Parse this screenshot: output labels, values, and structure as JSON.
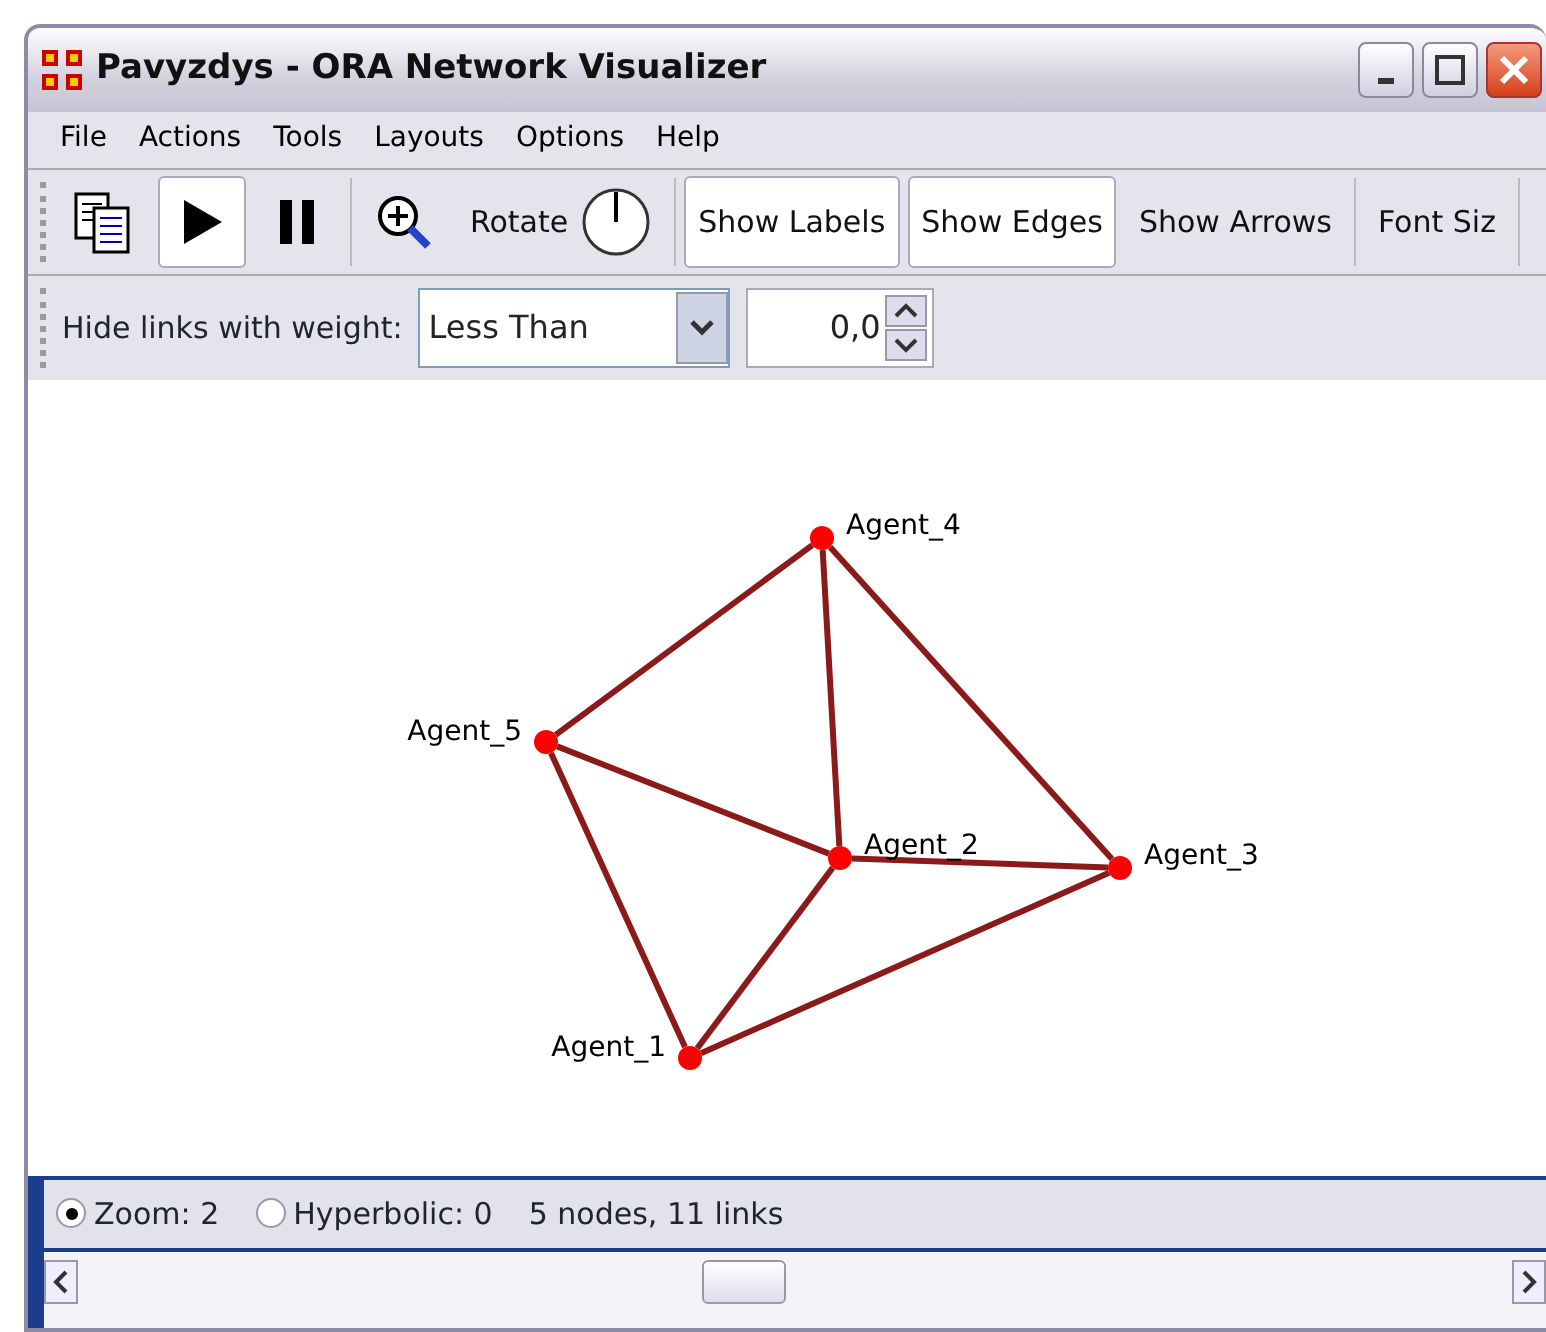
{
  "window": {
    "title": "Pavyzdys - ORA Network Visualizer"
  },
  "menu": [
    "File",
    "Actions",
    "Tools",
    "Layouts",
    "Options",
    "Help"
  ],
  "toolbar": [
    {
      "kind": "icon"
    },
    {
      "kind": "icon",
      "on": true
    },
    {
      "kind": "icon",
      "on": false
    },
    {
      "kind": "icon"
    },
    {
      "kind": "rotate",
      "label": "Rotate"
    },
    {
      "kind": "toggle",
      "label": "Show Labels",
      "on": true
    },
    {
      "kind": "toggle",
      "label": "Show Edges",
      "on": true
    },
    {
      "kind": "toggle",
      "label": "Show Arrows",
      "on": false
    },
    {
      "kind": "toggle",
      "label": "Font Siz",
      "on": false
    }
  ],
  "filter": {
    "label": "Hide links with weight:",
    "mode": "Less Than",
    "value": "0,0"
  },
  "network": {
    "nodes": [
      {
        "label": "Agent_4"
      },
      {
        "label": "Agent_5"
      },
      {
        "label": "Agent_2"
      },
      {
        "label": "Agent_3"
      },
      {
        "label": "Agent_1"
      }
    ]
  },
  "status": {
    "options": [
      {
        "label": "Zoom: 2",
        "selected": true
      },
      {
        "label": "Hyperbolic: 0",
        "selected": false
      }
    ],
    "summary": "5 nodes, 11 links"
  }
}
